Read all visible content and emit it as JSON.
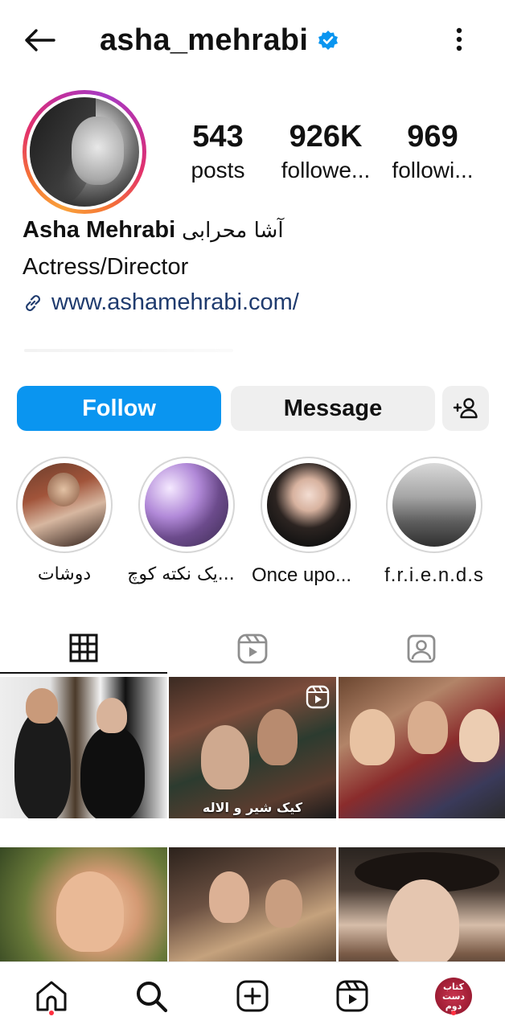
{
  "header": {
    "username": "asha_mehrabi",
    "verified": true,
    "icons": [
      "back-arrow-icon",
      "verified-badge-icon",
      "more-vertical-icon"
    ]
  },
  "profile": {
    "stats": {
      "posts_count": "543",
      "posts_label": "posts",
      "followers_count": "926K",
      "followers_label": "followe...",
      "following_count": "969",
      "following_label": "followi..."
    },
    "name": "Asha Mehrabi",
    "name_fa": "آشا محرابی",
    "category": "Actress/Director",
    "link": "www.ashamehrabi.com/"
  },
  "actions": {
    "follow_label": "Follow",
    "message_label": "Message",
    "add_user_icon": "add-user-icon"
  },
  "highlights": [
    {
      "label": "دوشات"
    },
    {
      "label": "یک نکته کوچ..."
    },
    {
      "label": "Once upo..."
    },
    {
      "label": "f.r.i.e.n.d.s"
    }
  ],
  "tabs": [
    "grid-icon",
    "reels-icon",
    "tagged-icon"
  ],
  "grid": {
    "cell_texts": [
      "کیک شیر و الاله"
    ]
  },
  "bottom_nav": {
    "items": [
      "home-icon",
      "search-icon",
      "create-icon",
      "reels-icon",
      "profile-avatar"
    ],
    "profile_text": "کتاب دست دوم"
  },
  "colors": {
    "follow_button": "#0a95f0",
    "secondary_button": "#efefef",
    "verified_badge": "#0a95f0",
    "notification_dot": "#ff3040"
  }
}
